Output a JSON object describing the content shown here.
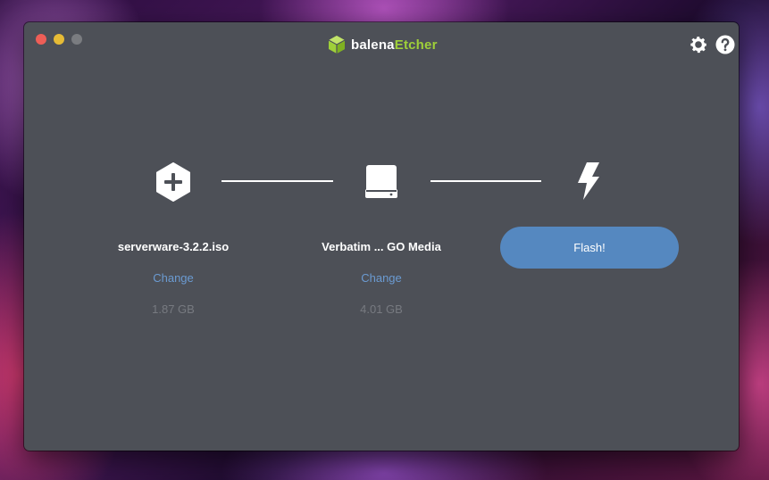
{
  "app": {
    "brand_prefix": "balena",
    "brand_suffix": "Etcher",
    "brand_accent_color": "#9fd039",
    "window_bg_color": "#4d5057"
  },
  "title_bar": {
    "buttons": [
      "close",
      "minimize",
      "maximize"
    ],
    "icons": [
      "gear-icon",
      "help-icon"
    ]
  },
  "steps": {
    "image": {
      "icon": "plus-hexagon-icon",
      "filename": "serverware-3.2.2.iso",
      "change_label": "Change",
      "size": "1.87 GB"
    },
    "drive": {
      "icon": "drive-icon",
      "name": "Verbatim ... GO Media",
      "change_label": "Change",
      "size": "4.01 GB"
    },
    "flash": {
      "icon": "lightning-bolt-icon",
      "button_label": "Flash!",
      "button_color": "#5588c0"
    }
  },
  "colors": {
    "link": "#6b9bd2",
    "muted": "#777a80"
  }
}
